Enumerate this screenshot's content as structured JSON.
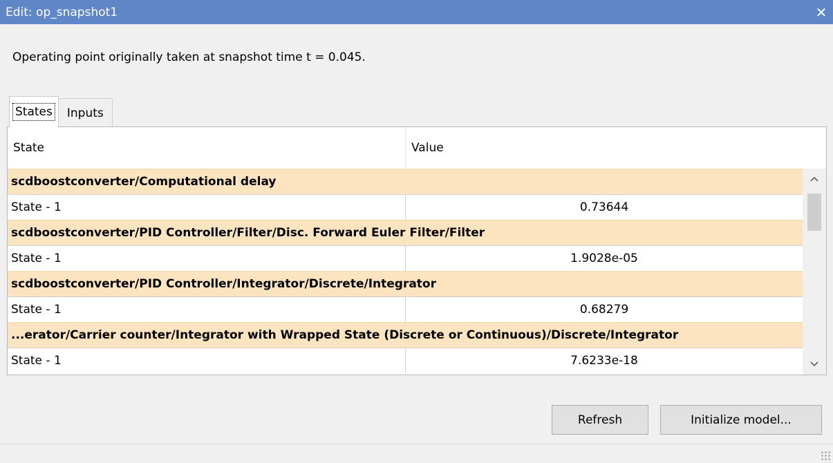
{
  "window": {
    "title": "Edit: op_snapshot1",
    "close_glyph": "✕"
  },
  "description": "Operating point originally taken at snapshot time t = 0.045.",
  "tabs": [
    {
      "label": "States",
      "active": true
    },
    {
      "label": "Inputs",
      "active": false
    }
  ],
  "table": {
    "columns": [
      "State",
      "Value"
    ],
    "groups": [
      {
        "name": "scdboostconverter/Computational delay",
        "rows": [
          {
            "state": "State - 1",
            "value": "0.73644"
          }
        ]
      },
      {
        "name": "scdboostconverter/PID Controller/Filter/Disc. Forward Euler Filter/Filter",
        "rows": [
          {
            "state": "State - 1",
            "value": "1.9028e-05"
          }
        ]
      },
      {
        "name": "scdboostconverter/PID Controller/Integrator/Discrete/Integrator",
        "rows": [
          {
            "state": "State - 1",
            "value": "0.68279"
          }
        ]
      },
      {
        "name": "...erator/Carrier counter/Integrator with Wrapped State (Discrete or Continuous)/Discrete/Integrator",
        "rows": [
          {
            "state": "State - 1",
            "value": "7.6233e-18"
          }
        ]
      }
    ]
  },
  "buttons": {
    "refresh": "Refresh",
    "initialize": "Initialize model..."
  },
  "icons": {
    "close": "close-icon",
    "scroll_up": "chevron-up-icon",
    "scroll_down": "chevron-down-icon",
    "grip": "resize-grip-icon"
  },
  "colors": {
    "titlebar": "#5f86c6",
    "group_row": "#fce4c0"
  }
}
